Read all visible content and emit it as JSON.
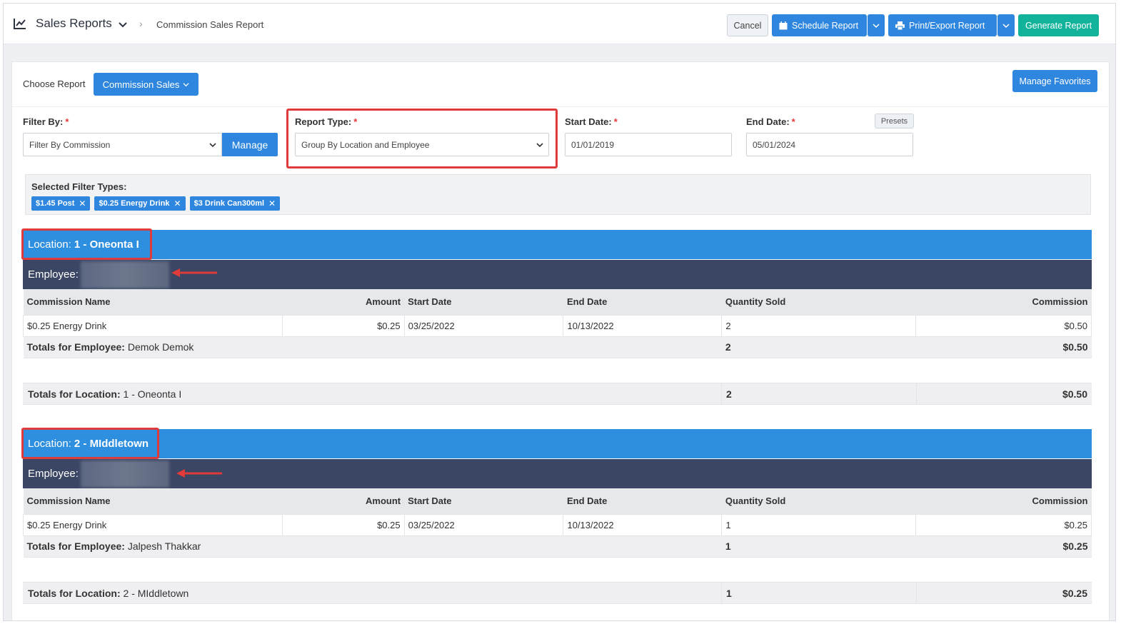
{
  "header": {
    "app_title": "Sales Reports",
    "breadcrumb": "Commission Sales Report",
    "cancel_label": "Cancel",
    "schedule_label": "Schedule Report",
    "print_label": "Print/Export Report",
    "generate_label": "Generate Report"
  },
  "toolbar": {
    "choose_label": "Choose Report",
    "report_select": "Commission Sales",
    "favorites_label": "Manage Favorites"
  },
  "filters": {
    "filter_by_label": "Filter By:",
    "filter_by_value": "Filter By Commission",
    "manage_label": "Manage",
    "report_type_label": "Report Type:",
    "report_type_value": "Group By Location and Employee",
    "start_date_label": "Start Date:",
    "start_date_value": "01/01/2019",
    "end_date_label": "End Date:",
    "end_date_value": "05/01/2024",
    "presets_label": "Presets",
    "required_mark": "*"
  },
  "selected_filters": {
    "label": "Selected Filter Types:",
    "tags": [
      "$1.45 Post",
      "$0.25 Energy Drink",
      "$3 Drink Can300ml"
    ],
    "remove_glyph": "✕"
  },
  "columns": [
    "Commission Name",
    "Amount",
    "Start Date",
    "End Date",
    "Quantity Sold",
    "Commission"
  ],
  "locations": [
    {
      "location_prefix": "Location:",
      "location_name": "1 - Oneonta I",
      "employee_prefix": "Employee:",
      "rows": [
        {
          "name": "$0.25 Energy Drink",
          "amount": "$0.25",
          "start": "03/25/2022",
          "end": "10/13/2022",
          "qty": "2",
          "commission": "$0.50"
        }
      ],
      "emp_total_label": "Totals for Employee:",
      "emp_total_name": "Demok Demok",
      "emp_total_qty": "2",
      "emp_total_commission": "$0.50",
      "loc_total_label": "Totals for Location:",
      "loc_total_name": "1 - Oneonta I",
      "loc_total_qty": "2",
      "loc_total_commission": "$0.50"
    },
    {
      "location_prefix": "Location:",
      "location_name": "2 - MIddletown",
      "employee_prefix": "Employee:",
      "rows": [
        {
          "name": "$0.25 Energy Drink",
          "amount": "$0.25",
          "start": "03/25/2022",
          "end": "10/13/2022",
          "qty": "1",
          "commission": "$0.25"
        }
      ],
      "emp_total_label": "Totals for Employee:",
      "emp_total_name": "Jalpesh Thakkar",
      "emp_total_qty": "1",
      "emp_total_commission": "$0.25",
      "loc_total_label": "Totals for Location:",
      "loc_total_name": "2 - MIddletown",
      "loc_total_qty": "1",
      "loc_total_commission": "$0.25"
    }
  ],
  "colors": {
    "primary": "#2e86de",
    "generate": "#12b39a",
    "employee_bar": "#3a4664",
    "highlight": "#e03a3a"
  }
}
